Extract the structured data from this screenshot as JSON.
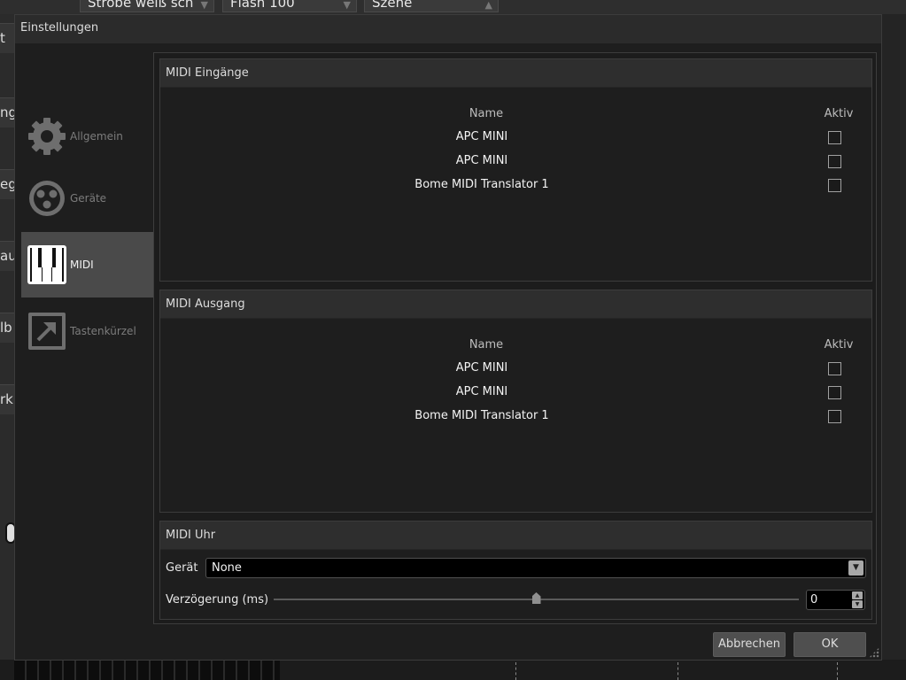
{
  "background": {
    "combos": [
      "Strobe weiß sch",
      "Flash 100",
      "Szene"
    ],
    "left_items": [
      "t",
      "ng",
      "egr",
      "au",
      "lb",
      "rki"
    ]
  },
  "dialog": {
    "title": "Einstellungen",
    "nav": [
      {
        "label": "Allgemein",
        "icon": "gear-icon"
      },
      {
        "label": "Geräte",
        "icon": "xlr-connector-icon"
      },
      {
        "label": "MIDI",
        "icon": "piano-keys-icon",
        "active": true
      },
      {
        "label": "Tastenkürzel",
        "icon": "shortcut-arrow-icon"
      }
    ],
    "midi_inputs": {
      "title": "MIDI Eingänge",
      "col_name": "Name",
      "col_active": "Aktiv",
      "rows": [
        {
          "name": "APC MINI",
          "active": false
        },
        {
          "name": "APC MINI",
          "active": false
        },
        {
          "name": "Bome MIDI Translator 1",
          "active": false
        }
      ]
    },
    "midi_output": {
      "title": "MIDI Ausgang",
      "col_name": "Name",
      "col_active": "Aktiv",
      "rows": [
        {
          "name": "APC MINI",
          "active": false
        },
        {
          "name": "APC MINI",
          "active": false
        },
        {
          "name": "Bome MIDI Translator 1",
          "active": false
        }
      ]
    },
    "midi_clock": {
      "title": "MIDI Uhr",
      "device_label": "Gerät",
      "device_value": "None",
      "delay_label": "Verzögerung (ms)",
      "delay_slider_fraction": 0.5,
      "delay_value": "0"
    },
    "buttons": {
      "cancel": "Abbrechen",
      "ok": "OK"
    }
  }
}
